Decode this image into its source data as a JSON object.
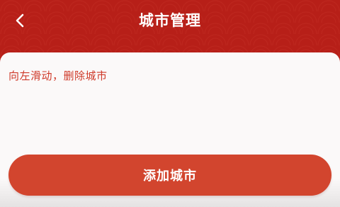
{
  "header": {
    "title": "城市管理",
    "back_icon": "chevron-left-icon"
  },
  "main": {
    "hint_text": "向左滑动，删除城市",
    "add_button_label": "添加城市"
  },
  "colors": {
    "header_bg": "#b71f18",
    "accent": "#d2452e",
    "hint_text": "#cf3a2a"
  }
}
